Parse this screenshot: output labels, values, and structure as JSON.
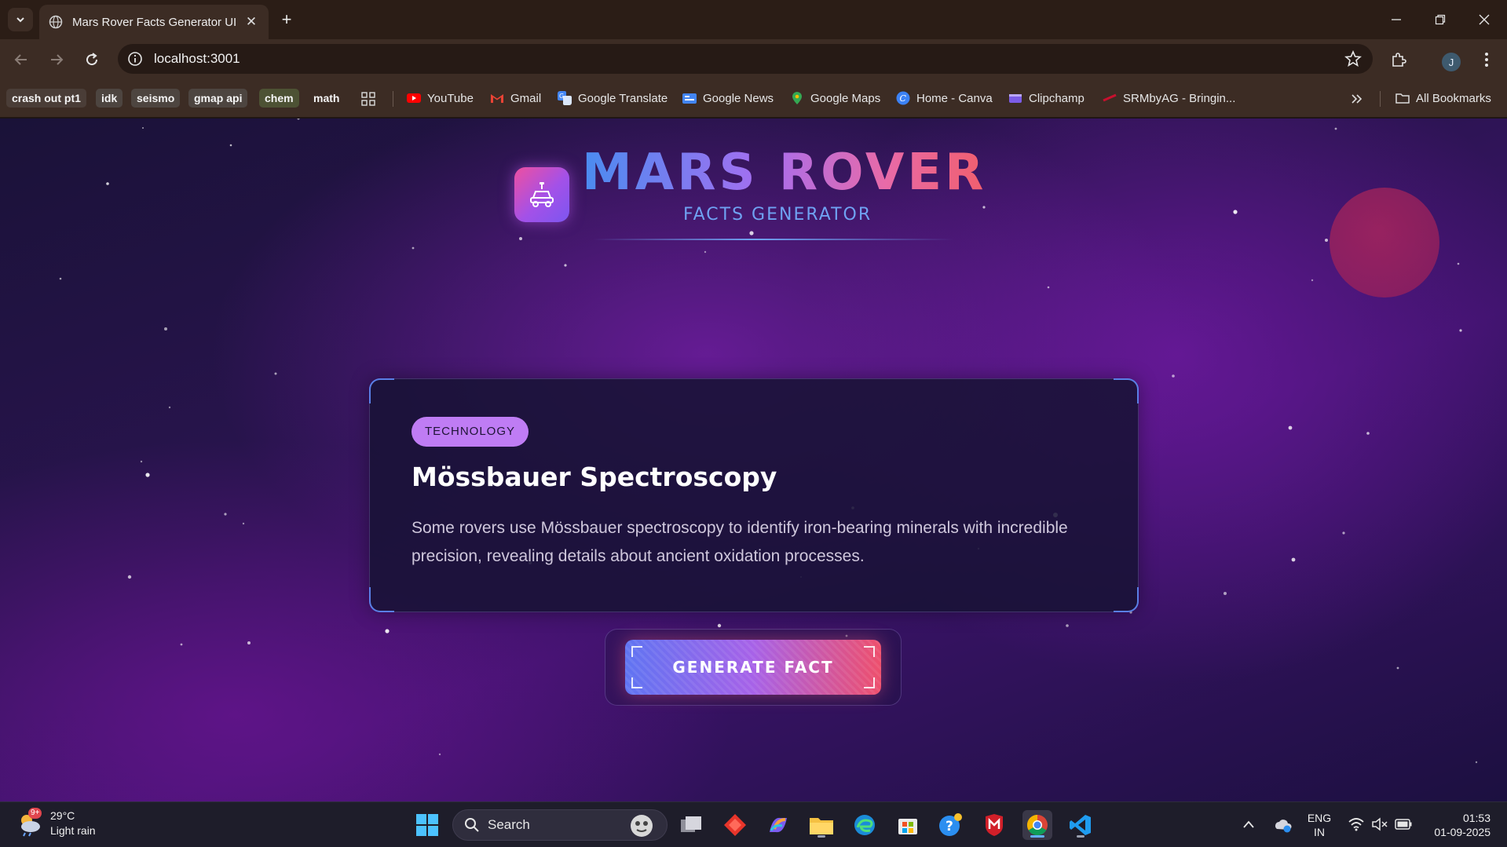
{
  "browser": {
    "tab_title": "Mars Rover Facts Generator UI",
    "url": "localhost:3001",
    "profile_initial": "J"
  },
  "bookmarks": {
    "chips": [
      {
        "label": "crash out pt1",
        "color": "#4a3d37"
      },
      {
        "label": "idk",
        "color": "#4d4540"
      },
      {
        "label": "seismo",
        "color": "#4d4540"
      },
      {
        "label": "gmap api",
        "color": "#4d4540"
      },
      {
        "label": "chem",
        "color": "#4d5234"
      },
      {
        "label": "math",
        "color": "#3c2c24"
      }
    ],
    "links": [
      {
        "label": "YouTube",
        "icon": "youtube-icon"
      },
      {
        "label": "Gmail",
        "icon": "gmail-icon"
      },
      {
        "label": "Google Translate",
        "icon": "translate-icon"
      },
      {
        "label": "Google News",
        "icon": "news-icon"
      },
      {
        "label": "Google Maps",
        "icon": "maps-icon"
      },
      {
        "label": "Home - Canva",
        "icon": "canva-icon"
      },
      {
        "label": "Clipchamp",
        "icon": "clipchamp-icon"
      },
      {
        "label": "SRMbyAG - Bringin...",
        "icon": "srm-icon"
      }
    ],
    "all_bookmarks": "All Bookmarks"
  },
  "app": {
    "title": "MARS ROVER",
    "subtitle": "FACTS GENERATOR",
    "fact": {
      "category": "TECHNOLOGY",
      "title": "Mössbauer Spectroscopy",
      "text": "Some rovers use Mössbauer spectroscopy to identify iron-bearing minerals with incredible precision, revealing details about ancient oxidation processes."
    },
    "generate_label": "GENERATE FACT",
    "colors": {
      "title_gradient_start": "#4a8cf0",
      "title_gradient_end": "#f05f6d",
      "category_badge": "#bf7cf4",
      "card_bg": "#181236",
      "accent_blue": "#6fa2f2"
    }
  },
  "taskbar": {
    "weather_temp": "29°C",
    "weather_desc": "Light rain",
    "weather_badge": "9+",
    "search_placeholder": "Search",
    "lang_top": "ENG",
    "lang_bottom": "IN",
    "time": "01:53",
    "date": "01-09-2025"
  }
}
